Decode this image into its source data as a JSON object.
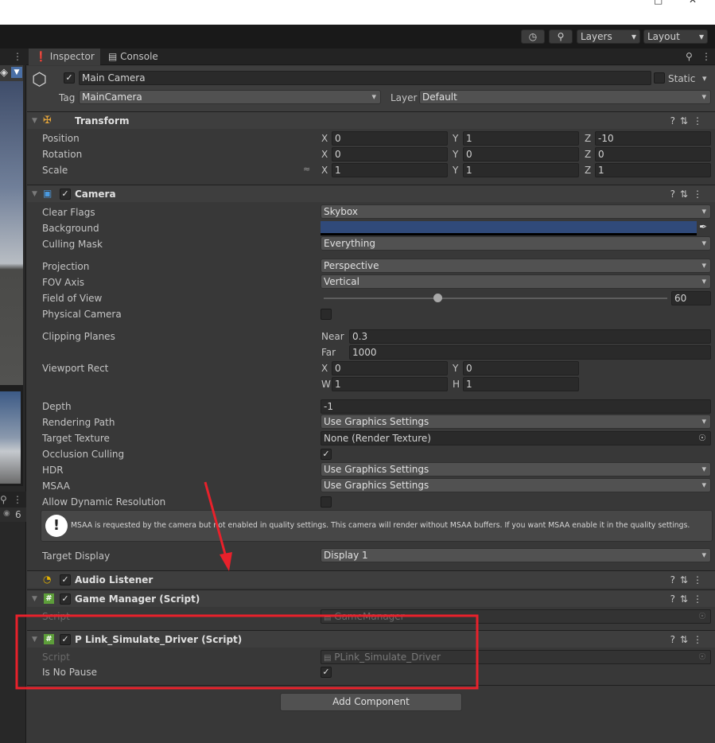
{
  "toolbar": {
    "layers": "Layers",
    "layout": "Layout"
  },
  "tabs": {
    "inspector": "Inspector",
    "console": "Console"
  },
  "object": {
    "name": "Main Camera",
    "static_label": "Static",
    "tag_label": "Tag",
    "tag_value": "MainCamera",
    "layer_label": "Layer",
    "layer_value": "Default"
  },
  "left": {
    "badge_count": "6"
  },
  "transform": {
    "title": "Transform",
    "position_label": "Position",
    "rotation_label": "Rotation",
    "scale_label": "Scale",
    "x": "X",
    "y": "Y",
    "z": "Z",
    "position": {
      "x": "0",
      "y": "1",
      "z": "-10"
    },
    "rotation": {
      "x": "0",
      "y": "0",
      "z": "0"
    },
    "scale": {
      "x": "1",
      "y": "1",
      "z": "1"
    }
  },
  "camera": {
    "title": "Camera",
    "clear_flags_label": "Clear Flags",
    "clear_flags": "Skybox",
    "background_label": "Background",
    "background_color": "#304a7a",
    "culling_mask_label": "Culling Mask",
    "culling_mask": "Everything",
    "projection_label": "Projection",
    "projection": "Perspective",
    "fov_axis_label": "FOV Axis",
    "fov_axis": "Vertical",
    "fov_label": "Field of View",
    "fov": "60",
    "fov_slider_fraction": 0.33,
    "physical_label": "Physical Camera",
    "clipping_label": "Clipping Planes",
    "near_label": "Near",
    "near": "0.3",
    "far_label": "Far",
    "far": "1000",
    "viewport_label": "Viewport Rect",
    "w": "W",
    "h": "H",
    "viewport": {
      "x": "0",
      "y": "0",
      "w": "1",
      "h": "1"
    },
    "depth_label": "Depth",
    "depth": "-1",
    "rendering_path_label": "Rendering Path",
    "rendering_path": "Use Graphics Settings",
    "target_texture_label": "Target Texture",
    "target_texture": "None (Render Texture)",
    "occlusion_label": "Occlusion Culling",
    "hdr_label": "HDR",
    "hdr": "Use Graphics Settings",
    "msaa_label": "MSAA",
    "msaa": "Use Graphics Settings",
    "dynamic_res_label": "Allow Dynamic Resolution",
    "warning": "MSAA is requested by the camera but not enabled in quality settings. This camera will render without MSAA buffers. If you want MSAA enable it in the quality settings.",
    "target_display_label": "Target Display",
    "target_display": "Display 1"
  },
  "audio_listener": {
    "title": "Audio Listener"
  },
  "game_manager": {
    "title": "Game Manager (Script)",
    "script_label": "Script",
    "script": "GameManager"
  },
  "plink": {
    "title": "P Link_Simulate_Driver (Script)",
    "script_label": "Script",
    "script": "PLink_Simulate_Driver",
    "no_pause_label": "Is No Pause"
  },
  "add_component": "Add Component",
  "colors": {
    "annotation": "#e8212b",
    "panel": "#383838",
    "header": "#3e3e3e"
  }
}
